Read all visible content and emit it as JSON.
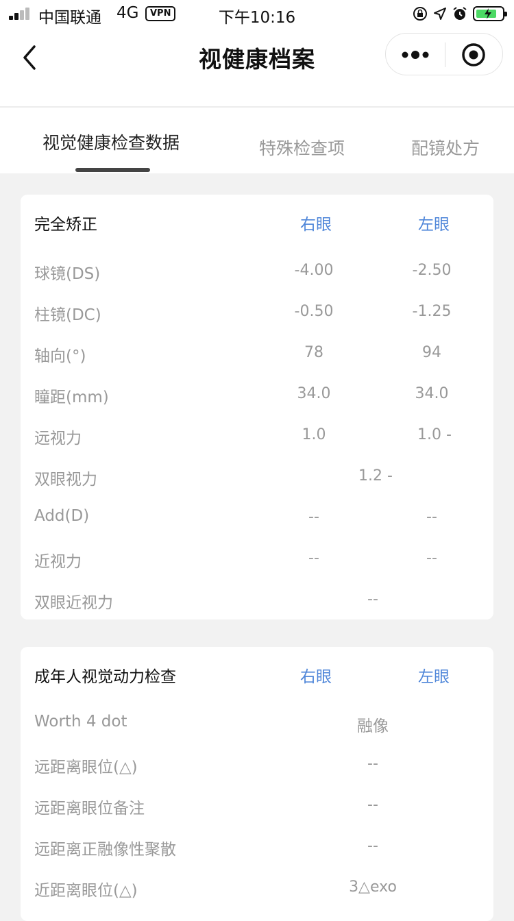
{
  "status": {
    "carrier": "中国联通",
    "network": "4G",
    "vpn": "VPN",
    "time": "下午10:16"
  },
  "nav": {
    "title": "视健康档案"
  },
  "tabs": [
    "视觉健康检查数据",
    "特殊检查项",
    "配镜处方"
  ],
  "card1": {
    "title": "完全矫正",
    "right_eye": "右眼",
    "left_eye": "左眼",
    "rows": [
      {
        "label": "球镜(DS)",
        "right": "-4.00",
        "left": "-2.50"
      },
      {
        "label": "柱镜(DC)",
        "right": "-0.50",
        "left": "-1.25"
      },
      {
        "label": "轴向(°)",
        "right": "78",
        "left": "94"
      },
      {
        "label": "瞳距(mm)",
        "right": "34.0",
        "left": "34.0"
      },
      {
        "label": "远视力",
        "right": "1.0",
        "left": "1.0 -"
      },
      {
        "label": "双眼视力",
        "both": "1.2 -"
      },
      {
        "label": "Add(D)",
        "right": "--",
        "left": "--"
      },
      {
        "label": "近视力",
        "right": "--",
        "left": "--"
      },
      {
        "label": "双眼近视力",
        "both": "--"
      }
    ]
  },
  "card2": {
    "title": "成年人视觉动力检查",
    "right_eye": "右眼",
    "left_eye": "左眼",
    "rows": [
      {
        "label": "Worth 4 dot",
        "both": "融像"
      },
      {
        "label": "远距离眼位(△)",
        "both": "--"
      },
      {
        "label": "远距离眼位备注",
        "both": "--"
      },
      {
        "label": "远距离正融像性聚散",
        "both": "--"
      },
      {
        "label": "近距离眼位(△)",
        "both": "3△exo"
      }
    ]
  }
}
